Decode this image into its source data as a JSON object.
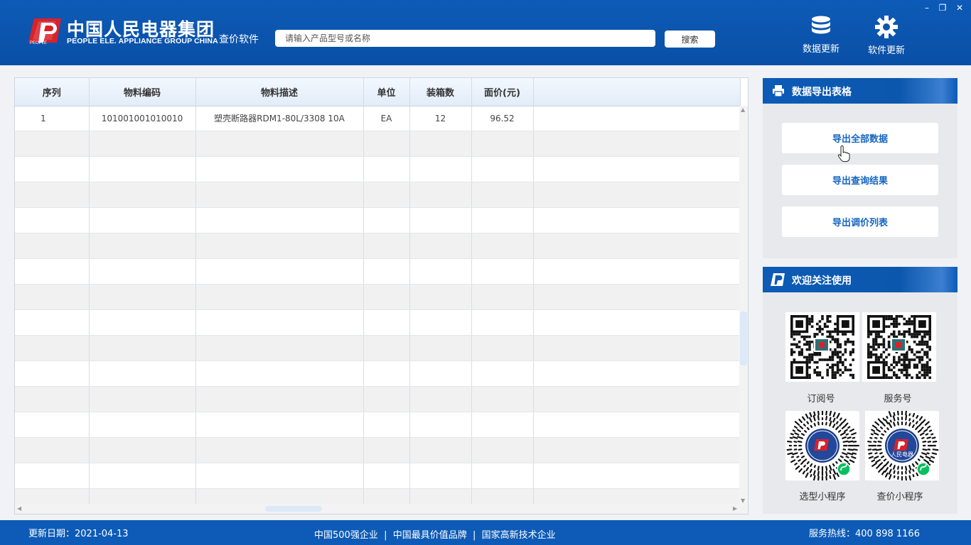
{
  "header": {
    "logo_text": "PEOPLE",
    "brand_cn": "中国人民电器集团",
    "brand_en": "PEOPLE ELE. APPLIANCE GROUP CHINA",
    "app_name": "查价软件",
    "search_placeholder": "请输入产品型号或名称",
    "search_button": "搜索",
    "data_update_label": "数据更新",
    "software_update_label": "软件更新",
    "window_controls": [
      "–",
      "❐",
      "✕"
    ]
  },
  "table": {
    "columns": [
      "序列",
      "物料编码",
      "物料描述",
      "单位",
      "装箱数",
      "面价(元)"
    ],
    "rows": [
      {
        "seq": "1",
        "code": "101001001010010",
        "desc": "塑壳断路器RDM1-80L/3308 10A",
        "unit": "EA",
        "box_qty": "12",
        "price": "96.52"
      }
    ]
  },
  "export": {
    "title": "数据导出表格",
    "buttons": [
      "导出全部数据",
      "导出查询结果",
      "导出调价列表"
    ]
  },
  "follow": {
    "title": "欢迎关注使用",
    "qrs": [
      "订阅号",
      "服务号",
      "选型小程序",
      "查价小程序"
    ],
    "badge_text": "人民电器"
  },
  "footer": {
    "update_date": "更新日期：2021-04-13",
    "slogan": "中国500强企业  |  中国最具价值品牌  |  国家高新技术企业",
    "hotline": "服务热线：400 898 1166"
  },
  "colors": {
    "brand_blue": "#0d5bb7",
    "link_blue": "#1565c0"
  }
}
